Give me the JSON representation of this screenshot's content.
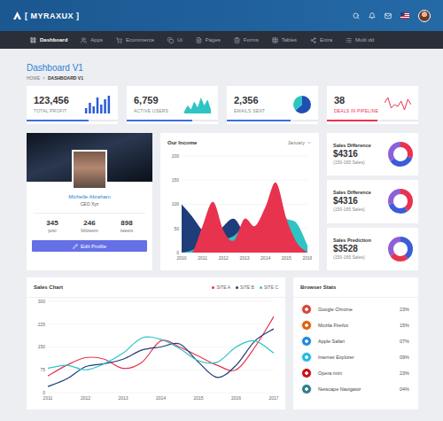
{
  "header": {
    "logo": "[ MYRAXUX ]"
  },
  "nav": [
    {
      "label": "Dashboard",
      "selected": true
    },
    {
      "label": "Apps",
      "selected": false
    },
    {
      "label": "Ecommerce",
      "selected": false
    },
    {
      "label": "Ui",
      "selected": false
    },
    {
      "label": "Pages",
      "selected": false
    },
    {
      "label": "Forms",
      "selected": false
    },
    {
      "label": "Tables",
      "selected": false
    },
    {
      "label": "Extra",
      "selected": false
    },
    {
      "label": "Multi dd",
      "selected": false
    }
  ],
  "page": {
    "title": "Dashboard V1",
    "separator": ">",
    "breadcrumb": [
      {
        "label": "HOME",
        "selected": false
      },
      {
        "label": "DASHBOARD V1",
        "selected": true
      }
    ]
  },
  "stats": [
    {
      "value": "123,456",
      "label": "TOTAL PROFIT",
      "kind": "bars",
      "values": [
        3,
        6,
        4,
        9,
        5,
        8,
        10
      ],
      "level": 0.68,
      "color": "#3b6fe0",
      "highlighted": false
    },
    {
      "value": "6,759",
      "label": "ACTIVE USERS",
      "kind": "area",
      "values": [
        1,
        4,
        2,
        6,
        3,
        8,
        4,
        7,
        2
      ],
      "level": 0.72,
      "color": "#3b6fe0",
      "highlighted": false
    },
    {
      "value": "2,356",
      "label": "EMAILS SENT",
      "kind": "pie",
      "values": [
        62,
        38
      ],
      "level": 0.7,
      "color": "#3b6fe0",
      "highlighted": false
    },
    {
      "value": "38",
      "label": "DEALS IN PIPELINE",
      "kind": "line",
      "values": [
        6,
        9,
        3,
        5,
        4,
        7,
        2,
        8,
        5
      ],
      "level": 0.55,
      "color": "#e8334f",
      "highlighted": true
    }
  ],
  "profile": {
    "name": "Michelle Abraham",
    "role": "CEO Xyz",
    "stats": [
      {
        "value": "345",
        "label": "post"
      },
      {
        "value": "246",
        "label": "followers"
      },
      {
        "value": "898",
        "label": "tweets"
      }
    ],
    "button": "Edit Profile"
  },
  "income": {
    "title": "Our Income",
    "period": "January",
    "y_ticks": [
      "0",
      "50",
      "100",
      "150",
      "200"
    ],
    "x_ticks": [
      "2010",
      "2011",
      "2012",
      "2013",
      "2014",
      "2015",
      "2016"
    ],
    "series": [
      {
        "color": "#1f3d7a",
        "values": [
          100,
          75,
          45,
          25,
          55,
          70,
          40,
          30,
          60,
          75,
          45,
          20,
          5
        ]
      },
      {
        "color": "#2ec4c4",
        "values": [
          0,
          5,
          20,
          45,
          30,
          35,
          55,
          50,
          70,
          85,
          70,
          60,
          15
        ]
      },
      {
        "color": "#e8334f",
        "values": [
          0,
          0,
          55,
          105,
          45,
          25,
          70,
          55,
          95,
          145,
          70,
          20,
          0
        ]
      }
    ]
  },
  "sales_cards": [
    {
      "title": "Sales Difference",
      "value": "$4316",
      "note": "(150-165 Sales)",
      "segments": [
        {
          "value": 30,
          "color": "#e8334f"
        },
        {
          "value": 35,
          "color": "#3b5bd8"
        },
        {
          "value": 35,
          "color": "#8e5fd6"
        }
      ]
    },
    {
      "title": "Sales Difference",
      "value": "$4316",
      "note": "(150-165 Sales)",
      "segments": [
        {
          "value": 40,
          "color": "#e8334f"
        },
        {
          "value": 30,
          "color": "#3b5bd8"
        },
        {
          "value": 30,
          "color": "#8e5fd6"
        }
      ]
    },
    {
      "title": "Sales Prediction",
      "value": "$3528",
      "note": "(150-165 Sales)",
      "segments": [
        {
          "value": 40,
          "color": "#3b5bd8"
        },
        {
          "value": 25,
          "color": "#e8334f"
        },
        {
          "value": 35,
          "color": "#8e5fd6"
        }
      ]
    }
  ],
  "sales_chart": {
    "title": "Sales Chart",
    "y_ticks": [
      "0",
      "75",
      "150",
      "225",
      "300"
    ],
    "x_ticks": [
      "2011",
      "2012",
      "2013",
      "2014",
      "2015",
      "2016",
      "2017"
    ],
    "series": [
      {
        "label": "SITE A",
        "color": "#e8334f",
        "values": [
          55,
          90,
          115,
          110,
          80,
          100,
          170,
          150,
          120,
          90,
          75,
          150,
          250
        ]
      },
      {
        "label": "SITE B",
        "color": "#1f3d7a",
        "values": [
          20,
          45,
          85,
          95,
          110,
          140,
          150,
          160,
          100,
          50,
          90,
          170,
          210
        ]
      },
      {
        "label": "SITE C",
        "color": "#2ec4c4",
        "values": [
          80,
          90,
          75,
          95,
          130,
          180,
          175,
          145,
          105,
          100,
          150,
          170,
          130
        ]
      }
    ]
  },
  "browser_stats": {
    "title": "Browser Stats",
    "items": [
      {
        "name": "Google Chrome",
        "share": "23%",
        "color": "#db4437"
      },
      {
        "name": "Mozila Firefox",
        "share": "15%",
        "color": "#e66000"
      },
      {
        "name": "Apple Safari",
        "share": "07%",
        "color": "#1e88e5"
      },
      {
        "name": "Internet Explorer",
        "share": "09%",
        "color": "#1ebbee"
      },
      {
        "name": "Opera mini",
        "share": "23%",
        "color": "#cc0f16"
      },
      {
        "name": "Netscape Navigator",
        "share": "04%",
        "color": "#2a7f8a"
      }
    ]
  }
}
